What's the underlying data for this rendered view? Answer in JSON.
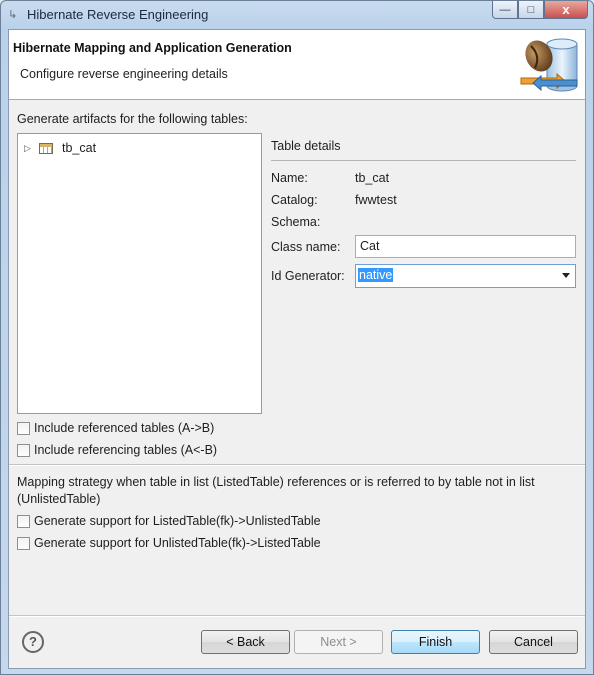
{
  "window": {
    "title": "Hibernate Reverse Engineering",
    "buttons": {
      "minimize": "—",
      "maximize": "□",
      "close": "x"
    }
  },
  "header": {
    "title": "Hibernate Mapping and Application Generation",
    "subtitle": "Configure reverse engineering details",
    "image_icon": "database-coffee-bean-icon"
  },
  "tables_section": {
    "label": "Generate artifacts for the following tables:",
    "tree": [
      {
        "label": "tb_cat",
        "icon": "table-icon",
        "expanded": false
      }
    ]
  },
  "details": {
    "title": "Table details",
    "name_label": "Name:",
    "name_value": "tb_cat",
    "catalog_label": "Catalog:",
    "catalog_value": "fwwtest",
    "schema_label": "Schema:",
    "schema_value": "",
    "classname_label": "Class name:",
    "classname_value": "Cat",
    "idgen_label": "Id Generator:",
    "idgen_value": "native"
  },
  "options": {
    "include_referenced": "Include referenced tables (A->B)",
    "include_referencing": "Include referencing tables (A<-B)"
  },
  "strategy": {
    "text": "Mapping strategy when table in list (ListedTable) references or is referred to by table not in list (UnlistedTable)",
    "listed_to_unlisted": "Generate support for ListedTable(fk)->UnlistedTable",
    "unlisted_to_listed": "Generate support for UnlistedTable(fk)->ListedTable"
  },
  "footer": {
    "help": "?",
    "back": "< Back",
    "next": "Next >",
    "finish": "Finish",
    "cancel": "Cancel"
  }
}
